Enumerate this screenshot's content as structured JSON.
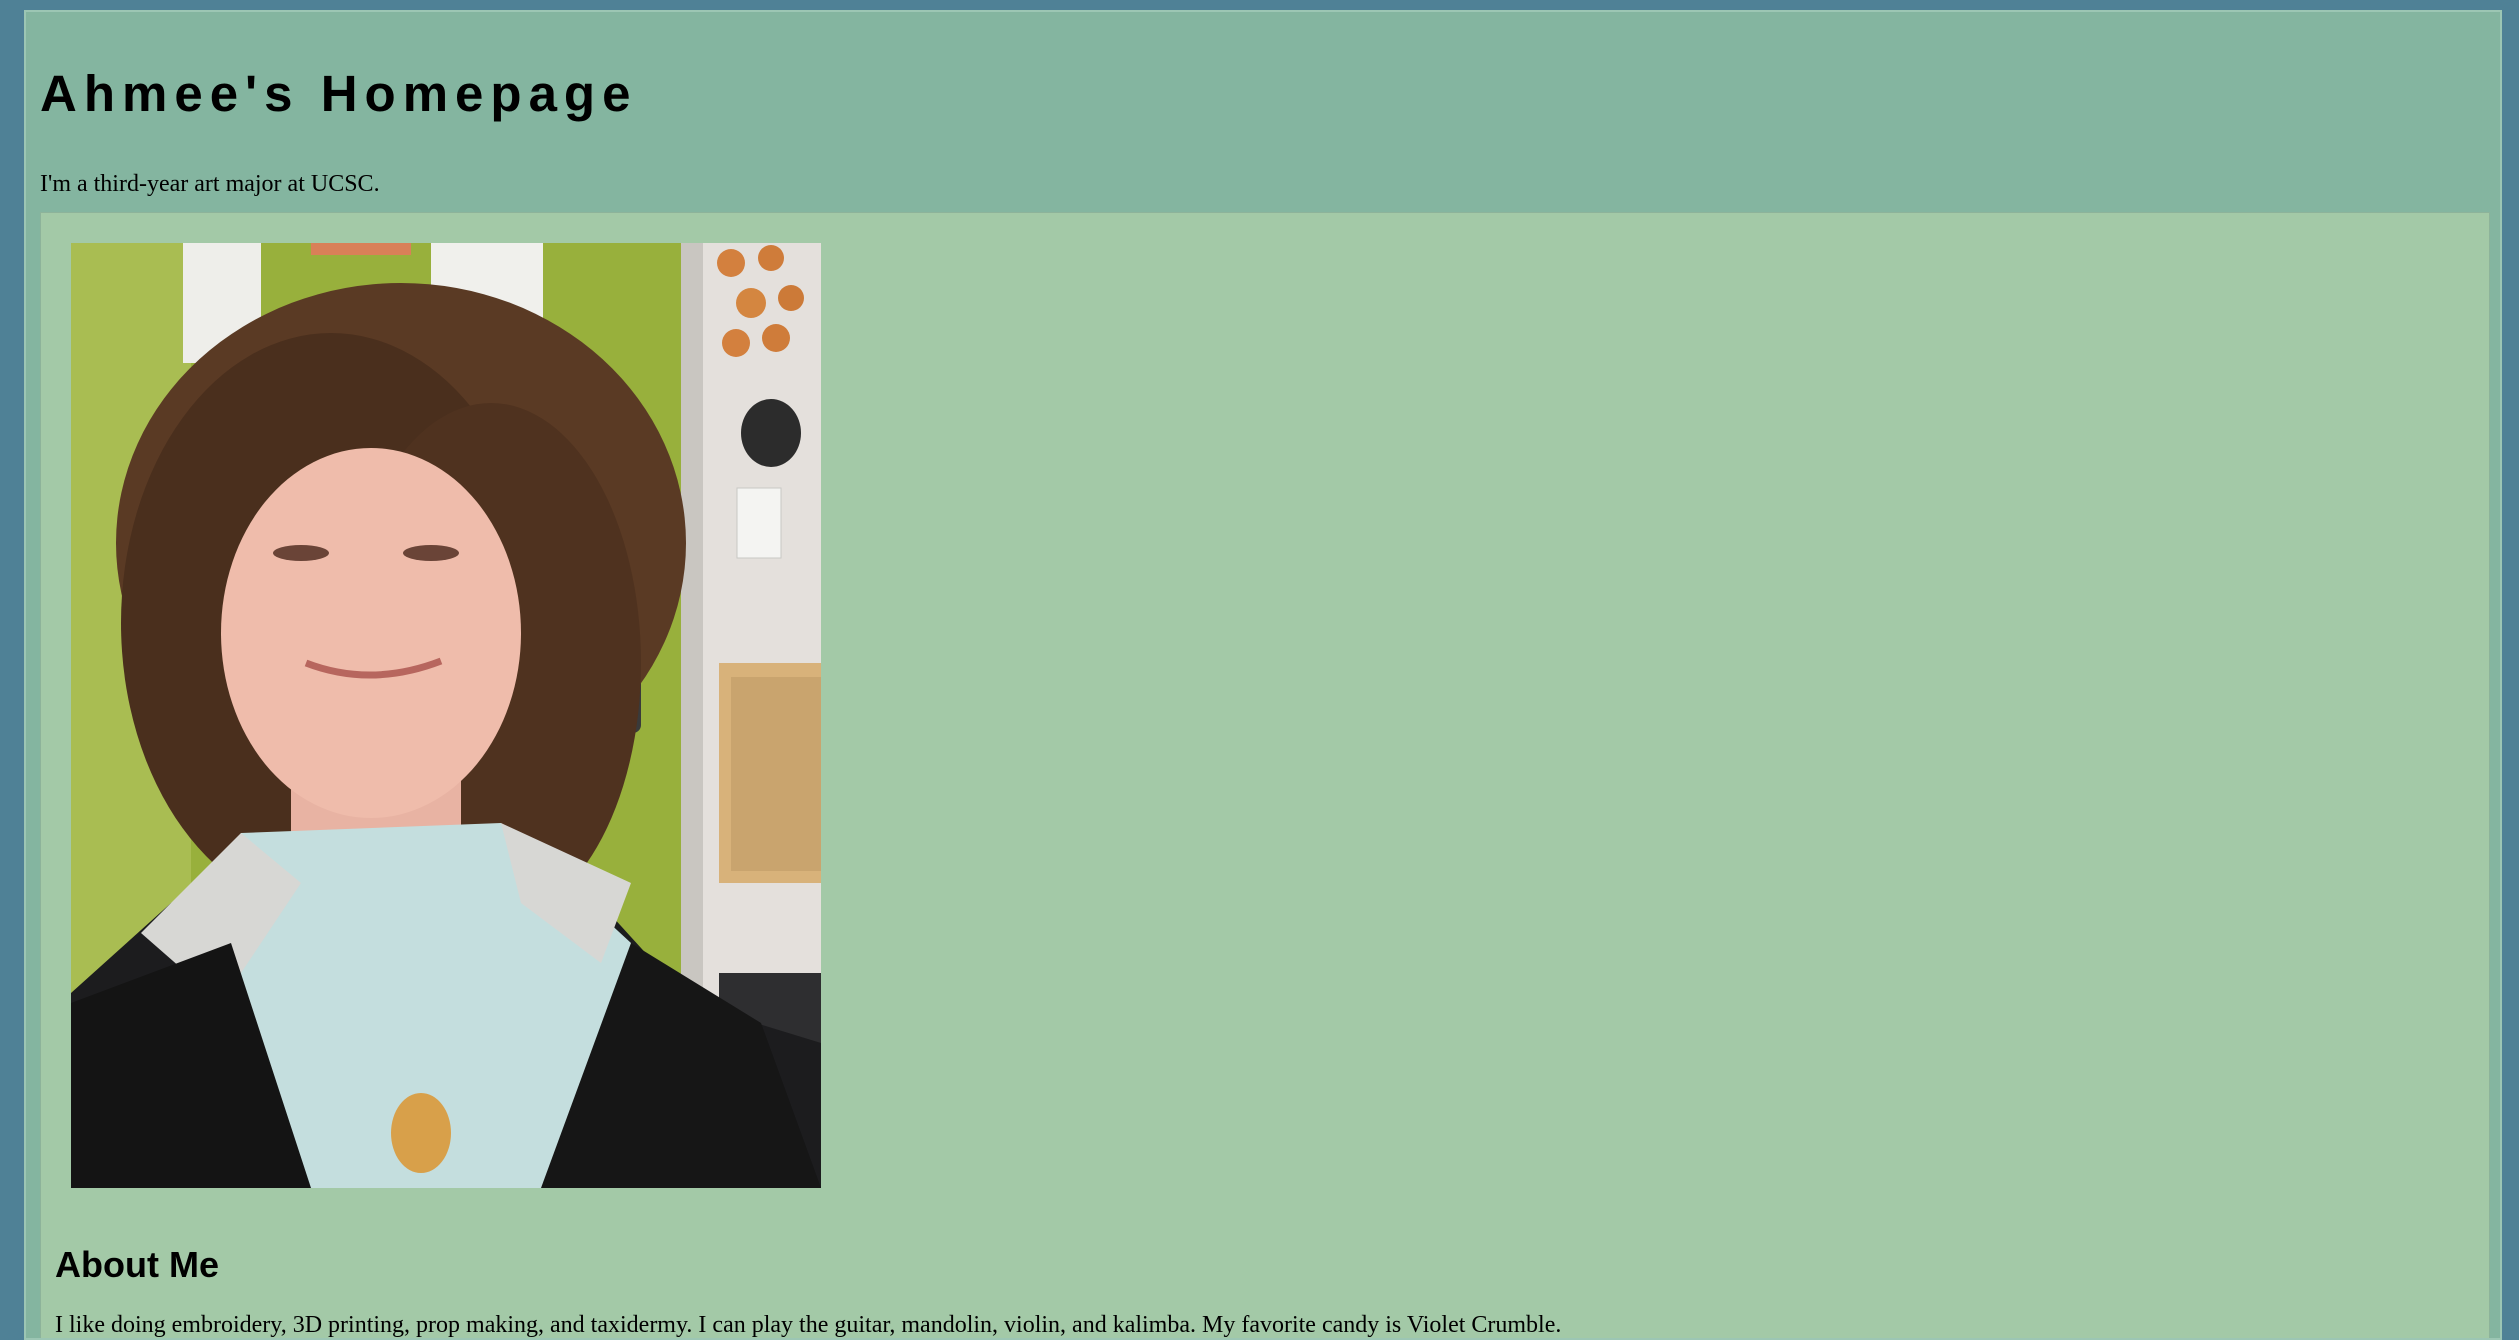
{
  "header": {
    "title": "Ahmee's Homepage",
    "tagline": "I'm a third-year art major at UCSC."
  },
  "main": {
    "photo_subject": "selfie of Ahmee with curly hair in a dorm room",
    "about": {
      "heading": "About Me",
      "text": "I like doing embroidery, 3D printing, prop making, and taxidermy. I can play the guitar, mandolin, violin, and kalimba. My favorite candy is Violet Crumble."
    }
  },
  "colors": {
    "outer_background": "#4f8196",
    "page_background": "#84b5a0",
    "panel_background": "#a3c9a7"
  }
}
